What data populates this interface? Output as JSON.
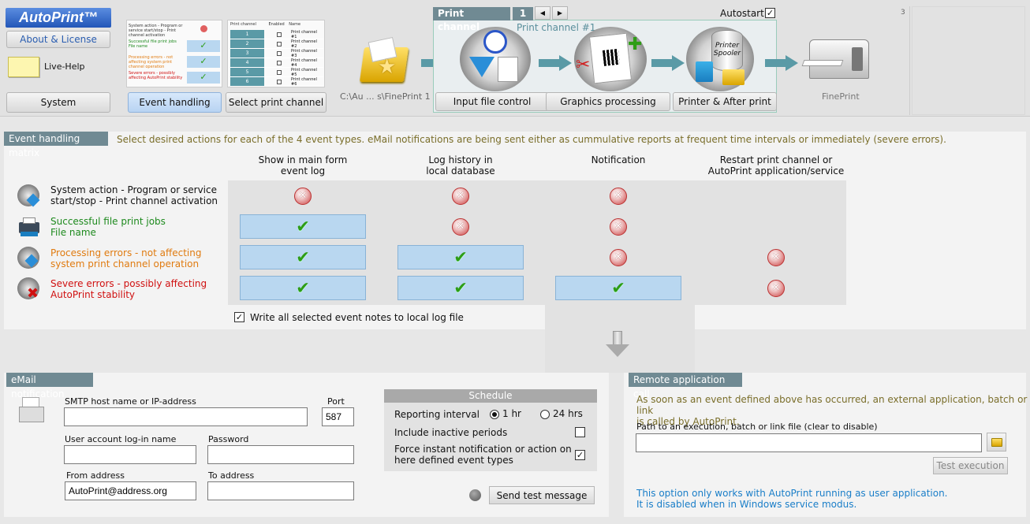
{
  "app": {
    "logo": "AutoPrint™"
  },
  "left_nav": {
    "about_label": "About & License",
    "live_help_label": "Live-Help",
    "system_label": "System"
  },
  "nav": {
    "event_handling_label": "Event handling",
    "select_channel_label": "Select print channel",
    "thumb_channel_cols": [
      "Print channel",
      "Enabled",
      "Name"
    ],
    "thumb_channel_rows": [
      "Print channel #1",
      "Print channel #2",
      "Print channel #3",
      "Print channel #4",
      "Print channel #5",
      "Print channel #6"
    ],
    "thumb_event_texts": [
      "System action - Program or service start/stop - Print channel activation",
      "Successful file print jobs File name",
      "Processing errors - not affecting system print channel operation",
      "Severe errors - possibly affecting AutoPrint stability"
    ]
  },
  "pipeline": {
    "folder_path": "C:\\Au ... s\\FinePrint 1",
    "channel_tab": "Print channel",
    "channel_number": "1",
    "channel_name": "Print channel #1",
    "autostart_label": "Autostart",
    "autostart_checked": true,
    "step1_label": "Input file control",
    "step2_label": "Graphics processing",
    "step3_label": "Printer & After print",
    "spooler_text": "Printer Spooler",
    "printer_label": "FinePrint",
    "corner_number": "3"
  },
  "matrix": {
    "title": "Event handling matrix",
    "hint": "Select desired actions for each of the 4 event types. eMail notifications are being sent either as cummulative reports at frequent time intervals or immediately (severe errors).",
    "columns": [
      "Show in main form\nevent log",
      "Log history in\nlocal database",
      "Notification",
      "Restart print channel or\nAutoPrint application/service"
    ],
    "rows": [
      {
        "label": "System action - Program or service\nstart/stop - Print channel activation",
        "color": "#111111",
        "cells": [
          "x",
          "x",
          "x",
          ""
        ]
      },
      {
        "label": "Successful file print jobs\nFile name",
        "color": "#1e8a1e",
        "cells": [
          "v",
          "x",
          "x",
          ""
        ]
      },
      {
        "label": "Processing errors - not affecting\nsystem print channel operation",
        "color": "#e07b10",
        "cells": [
          "v",
          "v",
          "x",
          "x"
        ]
      },
      {
        "label": "Severe errors - possibly affecting\nAutoPrint stability",
        "color": "#d01010",
        "cells": [
          "v",
          "v",
          "v",
          "x"
        ]
      }
    ],
    "write_log_label": "Write all selected event notes to local log file",
    "write_log_checked": true
  },
  "email": {
    "title": "eMail notification",
    "smtp_label": "SMTP host name or IP-address",
    "smtp_value": "",
    "port_label": "Port",
    "port_value": "587",
    "user_label": "User account log-in name",
    "user_value": "",
    "password_label": "Password",
    "password_value": "",
    "from_label": "From address",
    "from_value": "AutoPrint@address.org",
    "to_label": "To address",
    "to_value": "",
    "send_test_label": "Send test message"
  },
  "schedule": {
    "title": "Schedule",
    "interval_label": "Reporting interval",
    "opt_1hr": "1 hr",
    "opt_24hrs": "24 hrs",
    "selected": "1 hr",
    "inactive_label": "Include inactive periods",
    "inactive_checked": false,
    "force_label": "Force instant notification or action on\nhere defined event types",
    "force_checked": true
  },
  "remote": {
    "title": "Remote application call",
    "description": "As soon as an event defined above has occurred, an external application, batch or link\nis called by AutoPrint.",
    "path_label": "Path to an execution, batch or link file (clear to disable)",
    "path_value": "",
    "test_label": "Test execution",
    "note": "This option only works with AutoPrint running as user application.\nIt is disabled when in Windows service modus."
  }
}
